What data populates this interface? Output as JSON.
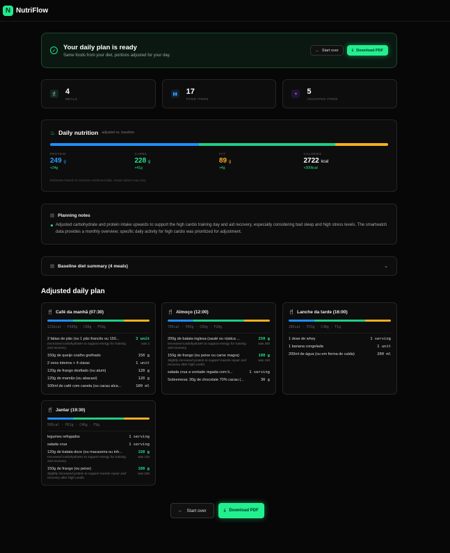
{
  "app": {
    "logo_letter": "N",
    "name": "NutriFlow"
  },
  "hero": {
    "title": "Your daily plan is ready",
    "subtitle": "Same foods from your diet, portions adjusted for your day.",
    "start_over": "Start over",
    "download": "Download PDF"
  },
  "stats": [
    {
      "value": "4",
      "label": "MEALS",
      "icon": "utensils-icon"
    },
    {
      "value": "17",
      "label": "FOOD ITEMS",
      "icon": "bar-chart-icon"
    },
    {
      "value": "5",
      "label": "ADJUSTED ITEMS",
      "icon": "sparkles-icon"
    }
  ],
  "nutrition": {
    "title": "Daily nutrition",
    "subtitle": "adjusted vs. baseline",
    "protein": {
      "label": "PROTEIN",
      "value": "249",
      "unit": "g",
      "delta": "+24g"
    },
    "carbs": {
      "label": "CARBS",
      "value": "228",
      "unit": "g",
      "delta": "+41g"
    },
    "fat": {
      "label": "FAT",
      "value": "89",
      "unit": "g",
      "delta": "+4g"
    },
    "calories": {
      "label": "CALORIES",
      "value": "2722",
      "unit": "kcal",
      "delta": "+300kcal"
    },
    "note": "Estimates based on common nutritional data. Actual values may vary.",
    "colors": {
      "protein": "#1e90ff",
      "carbs": "#1fcf86",
      "fat": "#f5b01f"
    }
  },
  "notes": {
    "title": "Planning notes",
    "body": "Adjusted carbohydrate and protein intake upwards to support the high cardio training day and aid recovery, especially considering bad sleep and high stress levels. The smartwatch data provides a monthly overview; specific daily activity for high cardio was prioritized for adjustment."
  },
  "baseline": {
    "title": "Baseline diet summary (4 meals)"
  },
  "plan_title": "Adjusted daily plan",
  "meals": [
    {
      "title": "Café da manhã (07:30)",
      "macros": "131kcal · P105g · C89g · F59g",
      "items": [
        {
          "name": "2 fatias de pão (ou 1 pão francês ou 150...",
          "qty": "3 unit",
          "adjusted": true,
          "was": "was 2",
          "note": "Increased carbohydrates to support energy for training and recovery."
        },
        {
          "name": "150g de queijo coalho grelhado",
          "qty": "150 g"
        },
        {
          "name": "2 ovos inteiros + 4 claras",
          "qty": "1 unit"
        },
        {
          "name": "120g de frango desfiado (ou atum)",
          "qty": "120 g"
        },
        {
          "name": "120g de mamão (ou abacaxi)",
          "qty": "120 g"
        },
        {
          "name": "100ml de café com canela (ou cacau alca...",
          "qty": "100 ml"
        }
      ]
    },
    {
      "title": "Almoço (12:00)",
      "macros": "705cal · P65g · C83g · F28g",
      "items": [
        {
          "name": "200g de batata inglesa (sauté ou rústica ...",
          "qty": "250 g",
          "adjusted": true,
          "was": "was 200",
          "note": "Increased carbohydrates to support energy for training and recovery."
        },
        {
          "name": "150g de frango (ou peixe ou carne magra)",
          "qty": "180 g",
          "adjusted": true,
          "was": "was 150",
          "note": "Slightly increased protein to support muscle repair and recovery after high cardio."
        },
        {
          "name": "salada crua a vontade regada com li...",
          "qty": "1 serving"
        },
        {
          "name": "Sobremesa: 30g de chocolate 70% cacau (...",
          "qty": "30 g"
        }
      ]
    },
    {
      "title": "Lanche da tarde (16:00)",
      "macros": "285cal · P31g · C38g · F1g",
      "items": [
        {
          "name": "1 dose de whey",
          "qty": "1 serving"
        },
        {
          "name": "1 banana congelada",
          "qty": "1 unit"
        },
        {
          "name": "200ml de água (ou em forma de calda)",
          "qty": "200 ml"
        }
      ]
    },
    {
      "title": "Jantar (19:30)",
      "macros": "505cal · P61g · C46g · F9g",
      "items": [
        {
          "name": "legumes refogados",
          "qty": "1 serving"
        },
        {
          "name": "salada crua",
          "qty": "1 serving"
        },
        {
          "name": "120g de batata doce (ou macaxeira ou inh...",
          "qty": "150 g",
          "adjusted": true,
          "was": "was 120",
          "note": "Increased carbohydrates to support energy for training and recovery."
        },
        {
          "name": "150g de frango (ou peixe)",
          "qty": "180 g",
          "adjusted": true,
          "was": "was 150",
          "note": "Slightly increased protein to support muscle repair and recovery after high cardio."
        }
      ]
    }
  ],
  "footer": {
    "start_over": "Start over",
    "download": "Download PDF"
  }
}
